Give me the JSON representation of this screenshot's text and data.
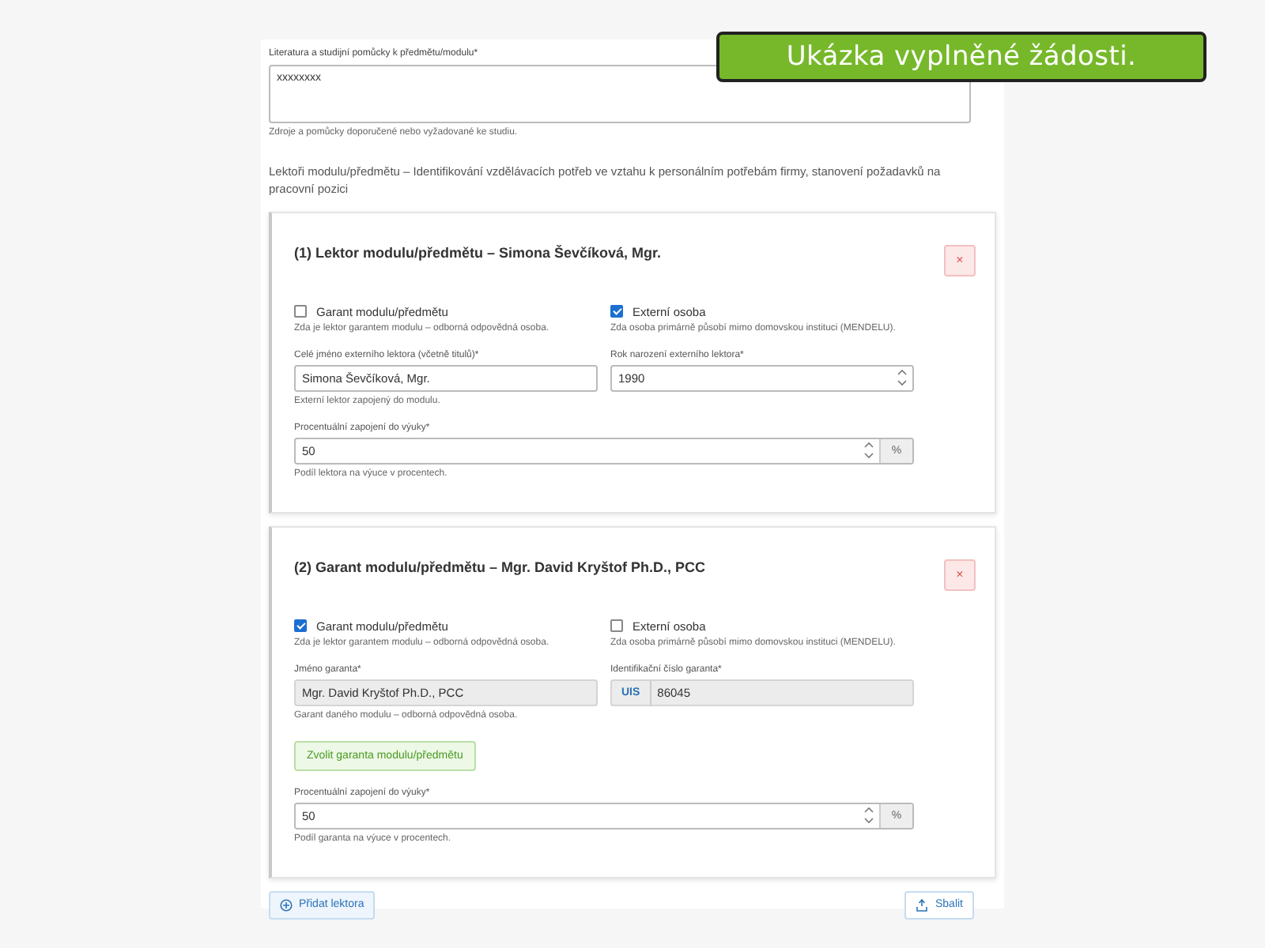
{
  "banner": {
    "text": "Ukázka vyplněné žádosti."
  },
  "literature": {
    "label": "Literatura a studijní pomůcky k předmětu/modulu*",
    "value": "xxxxxxxx",
    "hint": "Zdroje a pomůcky doporučené nebo vyžadované ke studiu."
  },
  "section_heading": "Lektoři modulu/předmětu – Identifikování vzdělávacích potřeb ve vztahu k personálním potřebám firmy, stanovení požadavků na pracovní pozici",
  "cards": [
    {
      "title": "(1) Lektor modulu/předmětu – Simona Ševčíková, Mgr.",
      "remove": "×",
      "rows": [
        [
          {
            "kind": "checkbox",
            "label": "Garant modulu/předmětu",
            "checked": false,
            "hint": "Zda je lektor garantem modulu – odborná odpovědná osoba."
          },
          {
            "kind": "checkbox",
            "label": "Externí osoba",
            "checked": true,
            "hint": "Zda osoba primárně působí mimo domovskou instituci (MENDELU)."
          }
        ],
        [
          {
            "kind": "text",
            "label": "Celé jméno externího lektora (včetně titulů)*",
            "value": "Simona Ševčíková, Mgr.",
            "hint": "Externí lektor zapojený do modulu."
          },
          {
            "kind": "number",
            "label": "Rok narození externího lektora*",
            "value": "1990"
          }
        ],
        [
          {
            "kind": "percent",
            "label": "Procentuální zapojení do výuky*",
            "value": "50",
            "unit": "%",
            "hint": "Podíl lektora na výuce v procentech."
          }
        ]
      ]
    },
    {
      "title": "(2) Garant modulu/předmětu – Mgr. David Kryštof Ph.D., PCC",
      "remove": "×",
      "rows": [
        [
          {
            "kind": "checkbox",
            "label": "Garant modulu/předmětu",
            "checked": true,
            "hint": "Zda je lektor garantem modulu – odborná odpovědná osoba."
          },
          {
            "kind": "checkbox",
            "label": "Externí osoba",
            "checked": false,
            "hint": "Zda osoba primárně působí mimo domovskou instituci (MENDELU)."
          }
        ],
        [
          {
            "kind": "readonly",
            "label": "Jméno garanta*",
            "value": "Mgr. David Kryštof Ph.D., PCC",
            "hint": "Garant daného modulu – odborná odpovědná osoba."
          },
          {
            "kind": "prefixed",
            "label": "Identifikační číslo garanta*",
            "prefix": "UIS",
            "value": "86045"
          }
        ],
        [
          {
            "kind": "button",
            "label": "Zvolit garanta modulu/předmětu"
          }
        ],
        [
          {
            "kind": "percent",
            "label": "Procentuální zapojení do výuky*",
            "value": "50",
            "unit": "%",
            "hint": "Podíl garanta na výuce v procentech."
          }
        ]
      ]
    }
  ],
  "actions": {
    "add": "Přidat lektora",
    "collapse": "Sbalit"
  }
}
